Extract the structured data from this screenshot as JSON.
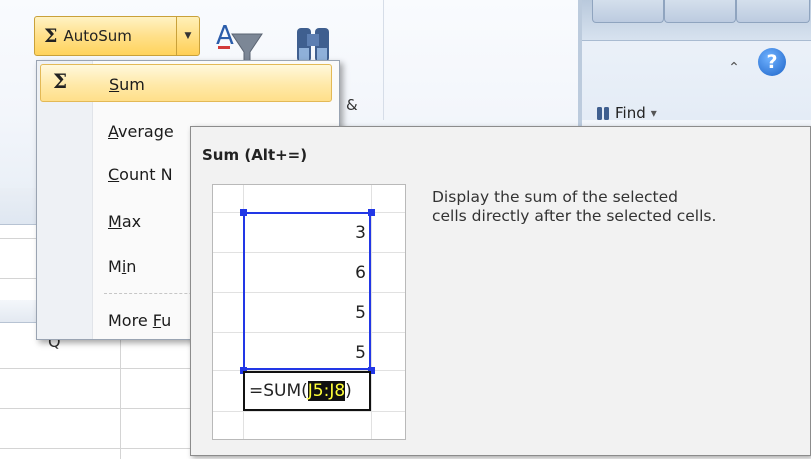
{
  "ribbon": {
    "autosum_label": "AutoSum",
    "sigma": "Σ",
    "find_label": "Find",
    "find_arrow": "▾",
    "amp": "&",
    "help": "?",
    "collapse": "⌃"
  },
  "sheet": {
    "column_letter": "Q"
  },
  "menu": {
    "items": [
      {
        "label_pre": "",
        "label_u": "S",
        "label_post": "um"
      },
      {
        "label_pre": "",
        "label_u": "A",
        "label_post": "verage"
      },
      {
        "label_pre": "",
        "label_u": "C",
        "label_post": "ount N"
      },
      {
        "label_pre": "",
        "label_u": "M",
        "label_post": "ax"
      },
      {
        "label_pre": "M",
        "label_u": "i",
        "label_post": "n"
      },
      {
        "label_pre": "More ",
        "label_u": "F",
        "label_post": "u"
      }
    ]
  },
  "tooltip": {
    "title": "Sum (Alt+=)",
    "description_line1": "Display the sum of the selected",
    "description_line2": "cells directly after the selected cells.",
    "values": [
      "3",
      "6",
      "5",
      "5"
    ],
    "formula_prefix": "=SUM(",
    "formula_ref": "J5:J8",
    "formula_suffix": ")"
  },
  "colors": {
    "accent_highlight": "#ffe08a",
    "selection_border": "#2237e6",
    "range_text": "#ffff38"
  }
}
